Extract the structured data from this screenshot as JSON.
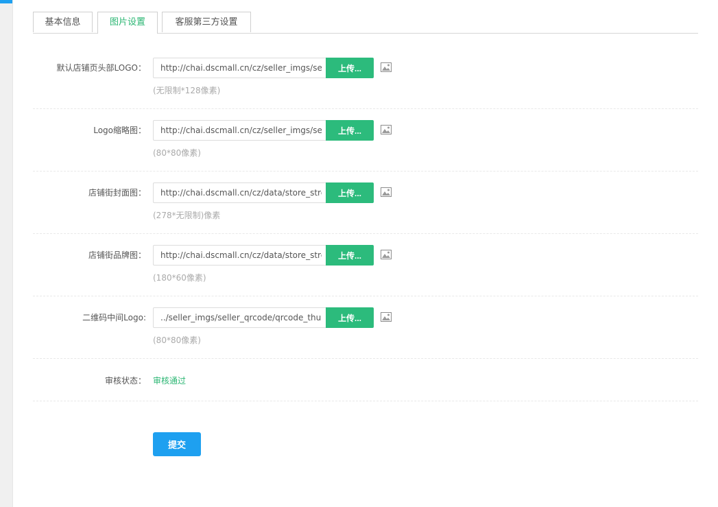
{
  "tabs": [
    {
      "label": "基本信息",
      "active": false
    },
    {
      "label": "图片设置",
      "active": true
    },
    {
      "label": "客服第三方设置",
      "active": false
    }
  ],
  "rows": [
    {
      "label": "默认店铺页头部LOGO：",
      "value": "http://chai.dscmall.cn/cz/seller_imgs/seller_logo/logo_top.png",
      "button": "上传...",
      "hint": "(无限制*128像素)"
    },
    {
      "label": "Logo缩略图：",
      "value": "http://chai.dscmall.cn/cz/seller_imgs/seller_logo/logo_thumb.png",
      "button": "上传...",
      "hint": "(80*80像素)"
    },
    {
      "label": "店铺街封面图：",
      "value": "http://chai.dscmall.cn/cz/data/store_street/street_thumb.jpg",
      "button": "上传...",
      "hint": "(278*无限制)像素"
    },
    {
      "label": "店铺街品牌图：",
      "value": "http://chai.dscmall.cn/cz/data/store_street/brand_thumb.jpg",
      "button": "上传...",
      "hint": "(180*60像素)"
    },
    {
      "label": "二维码中间Logo:",
      "value": "../seller_imgs/seller_qrcode/qrcode_thumb.png",
      "button": "上传...",
      "hint": "(80*80像素)"
    }
  ],
  "status": {
    "label": "审核状态：",
    "value": "审核通过"
  },
  "submit_label": "提交",
  "colors": {
    "accent_green": "#2cbb7c",
    "status_green": "#2bb673",
    "submit_blue": "#1ea0f0",
    "hint_gray": "#aaaaaa"
  },
  "icons": {
    "image_preview": "image-icon"
  }
}
